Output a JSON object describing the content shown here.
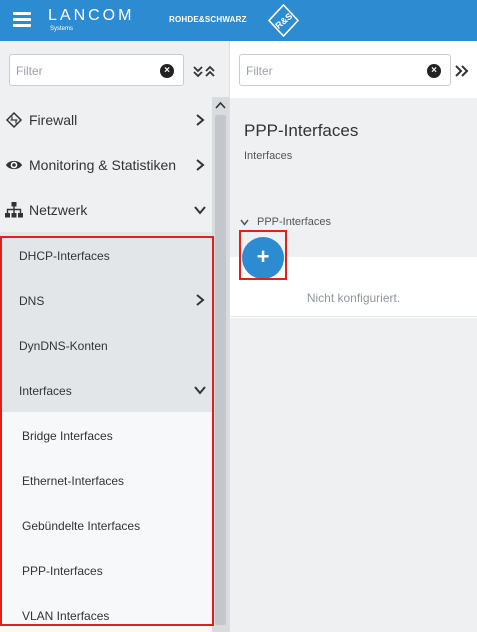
{
  "header": {
    "brand": "LANCOM",
    "brand_sub": "Systems",
    "partner": "ROHDE&SCHWARZ",
    "partner_logo_text": "R&S",
    "menu_icon": "hamburger-icon",
    "background": "#2d8bd2"
  },
  "left_filter": {
    "placeholder": "Filter",
    "clear_icon": "clear-icon",
    "collapse_icon": "collapse-expand-icon"
  },
  "nav": {
    "items": [
      {
        "label": "Firewall",
        "icon": "firewall-icon",
        "chevron": "right"
      },
      {
        "label": "Monitoring & Statistiken",
        "icon": "eye-icon",
        "chevron": "right"
      },
      {
        "label": "Netzwerk",
        "icon": "network-icon",
        "chevron": "down"
      },
      {
        "label": "DHCP-Interfaces"
      },
      {
        "label": "DNS",
        "chevron": "right"
      },
      {
        "label": "DynDNS-Konten"
      },
      {
        "label": "Interfaces",
        "chevron": "down"
      },
      {
        "label": "Bridge Interfaces"
      },
      {
        "label": "Ethernet-Interfaces"
      },
      {
        "label": "Gebündelte Interfaces"
      },
      {
        "label": "PPP-Interfaces"
      },
      {
        "label": "VLAN Interfaces"
      }
    ]
  },
  "right_filter": {
    "placeholder": "Filter",
    "expand_icon": "double-chevron-right-icon"
  },
  "main": {
    "title": "PPP-Interfaces",
    "subtitle": "Interfaces",
    "section_label": "PPP-Interfaces",
    "add_label": "+",
    "empty_text": "Nicht konfiguriert."
  },
  "colors": {
    "accent": "#2d8bd2",
    "highlight": "#e0201b"
  }
}
